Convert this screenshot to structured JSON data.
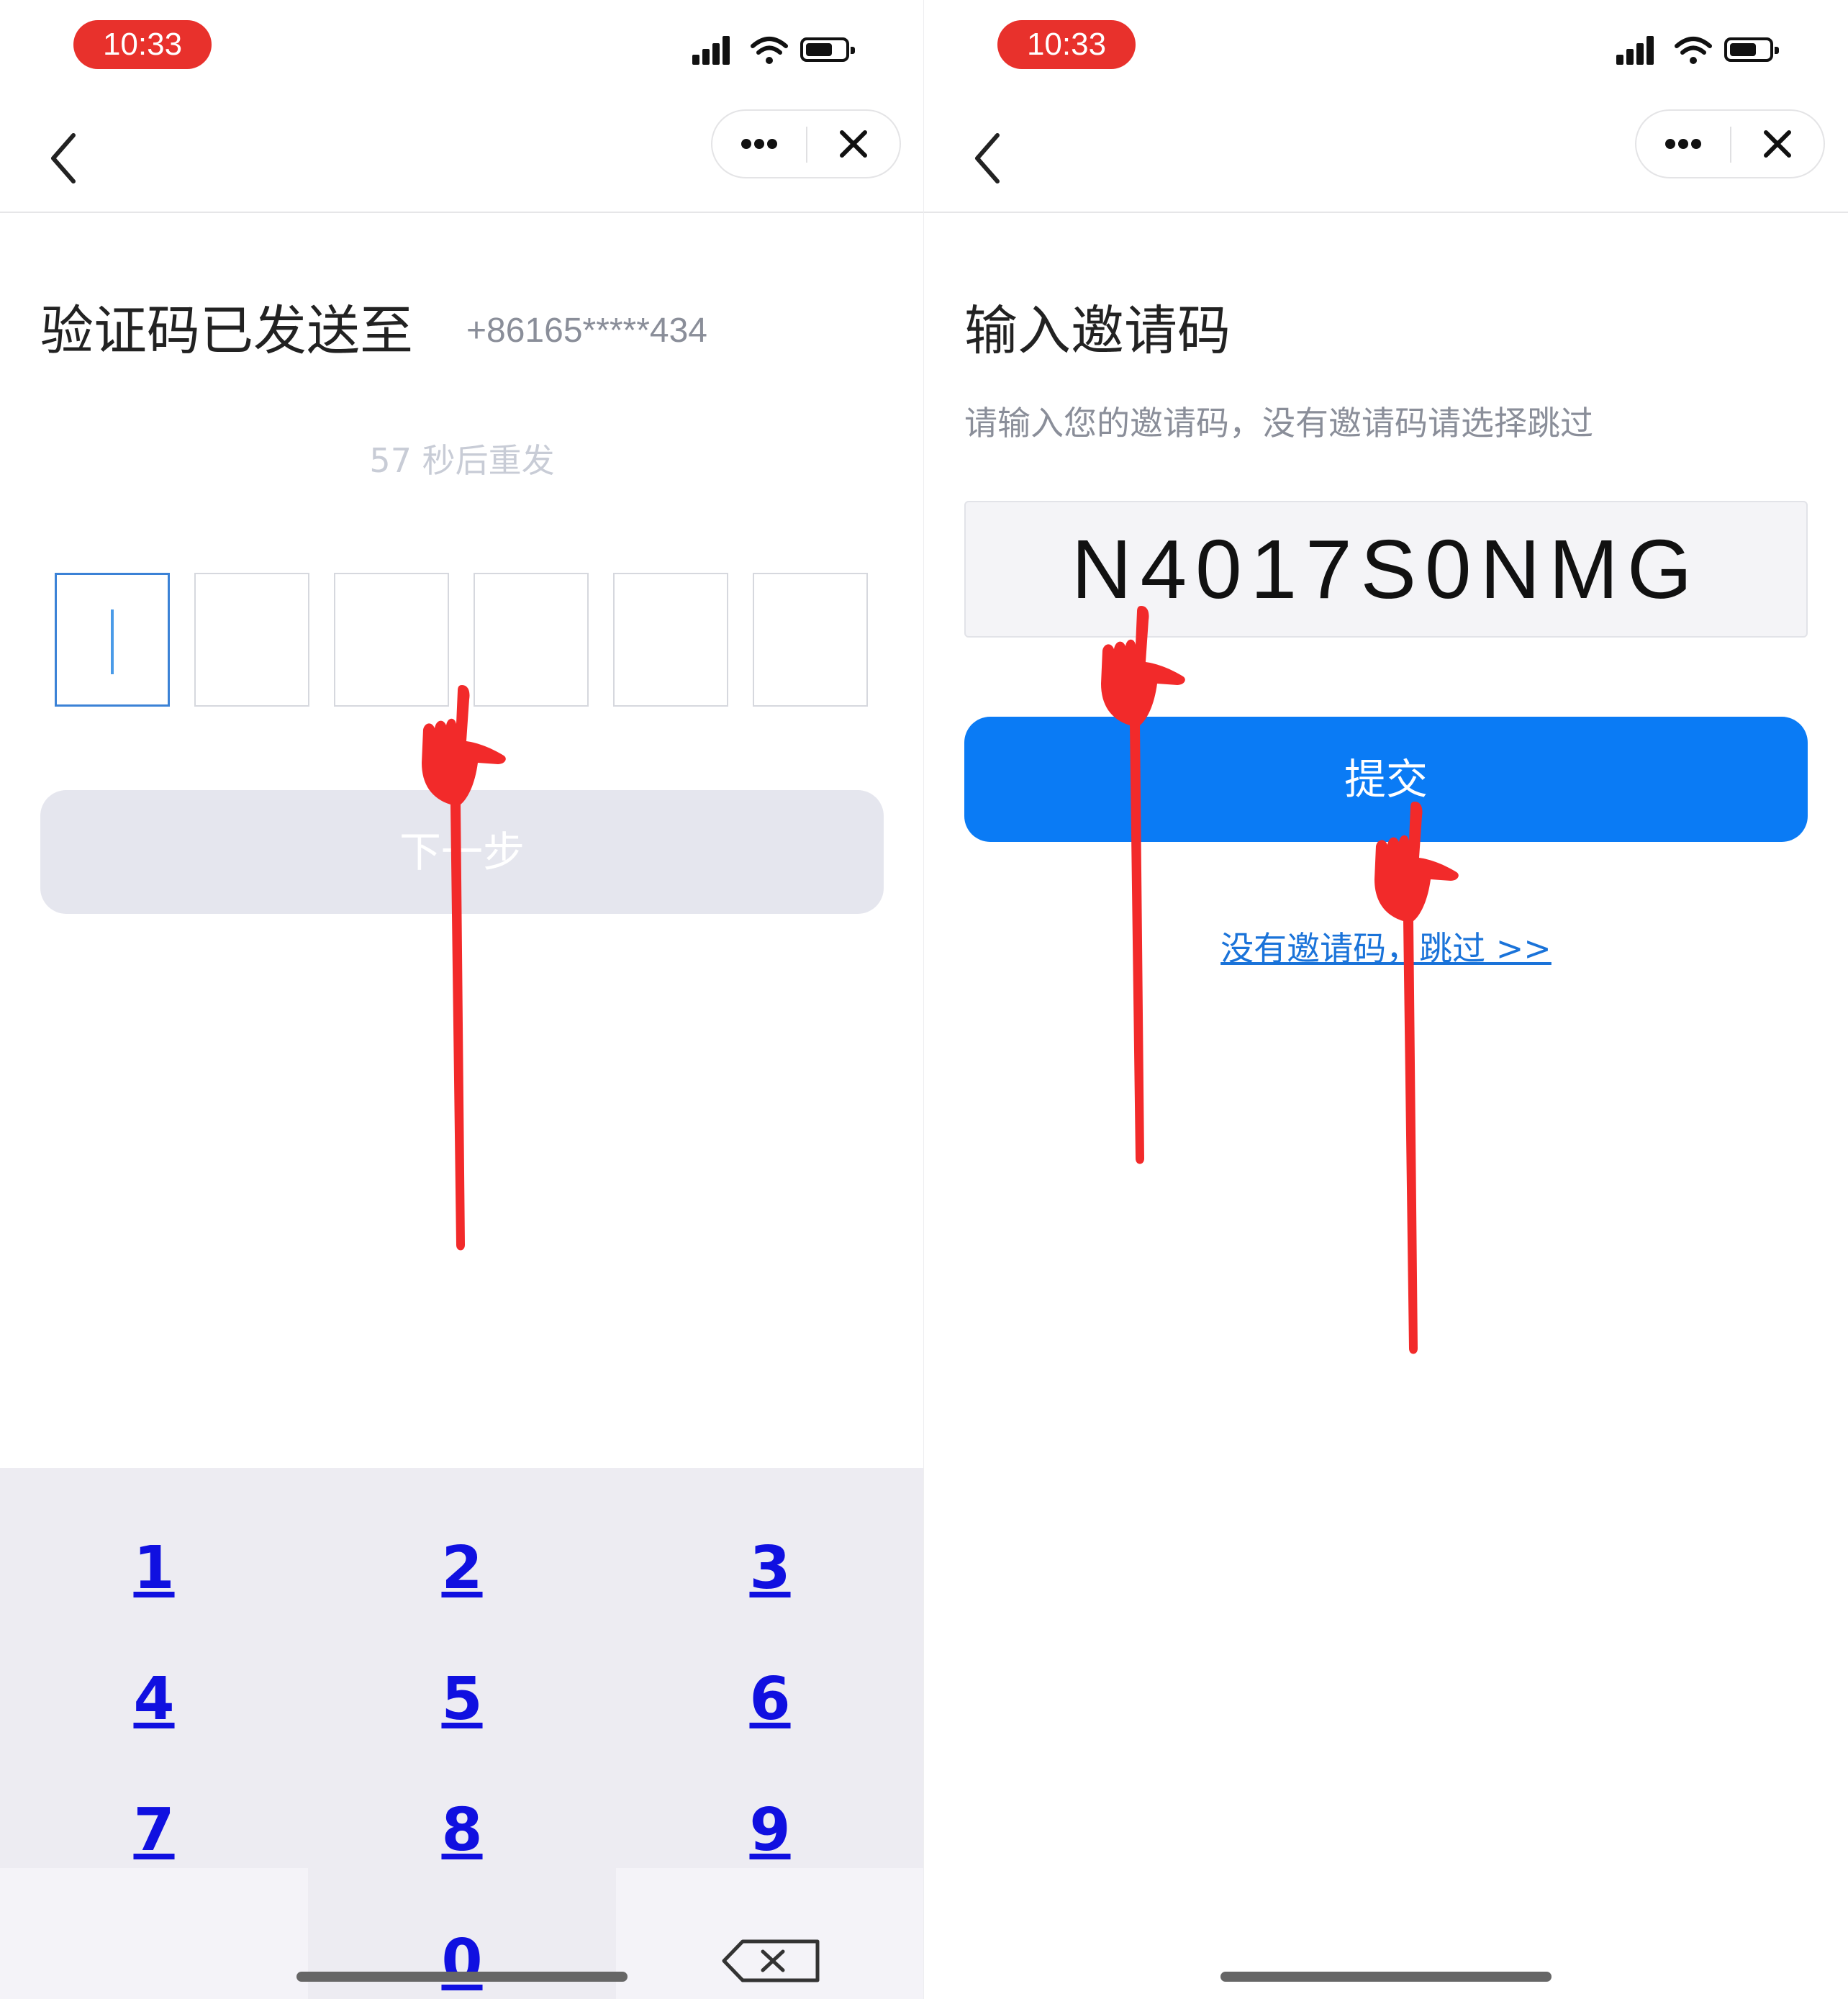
{
  "status_bar": {
    "time": "10:33"
  },
  "left_screen": {
    "title": "验证码已发送至",
    "phone": "+86165*****434",
    "resend": "57 秒后重发",
    "code_cells": 6,
    "next_label": "下一步",
    "keypad": [
      "1",
      "2",
      "3",
      "4",
      "5",
      "6",
      "7",
      "8",
      "9",
      "0"
    ]
  },
  "right_screen": {
    "title": "输入邀请码",
    "subtitle": "请输入您的邀请码，没有邀请码请选择跳过",
    "invite_code": "N4017S0NMG",
    "submit_label": "提交",
    "skip_link": "没有邀请码，跳过 >>"
  },
  "colors": {
    "accent": "#0a7bf5",
    "time_pill": "#e8312c",
    "annotation": "#f22a2a"
  }
}
